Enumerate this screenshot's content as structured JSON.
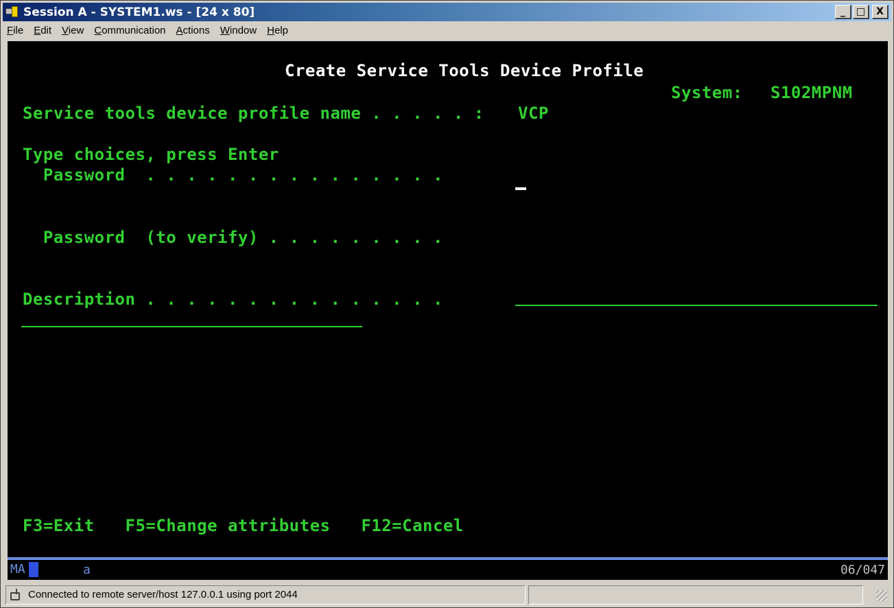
{
  "window": {
    "title": "Session A - SYSTEM1.ws - [24 x 80]",
    "buttons": {
      "minimize": "_",
      "maximize": "□",
      "close": "X"
    }
  },
  "menubar": {
    "items": [
      {
        "label": "File",
        "underline": "F",
        "rest": "ile"
      },
      {
        "label": "Edit",
        "underline": "E",
        "rest": "dit"
      },
      {
        "label": "View",
        "underline": "V",
        "rest": "iew"
      },
      {
        "label": "Communication",
        "underline": "C",
        "rest": "ommunication"
      },
      {
        "label": "Actions",
        "underline": "A",
        "rest": "ctions"
      },
      {
        "label": "Window",
        "underline": "W",
        "rest": "indow"
      },
      {
        "label": "Help",
        "underline": "H",
        "rest": "elp"
      }
    ]
  },
  "screen": {
    "heading": "Create Service Tools Device Profile",
    "system_label": "System:",
    "system_value": "S102MPNM",
    "profile_name_label": "Service tools device profile name . . . . . :",
    "profile_name_value": "VCP",
    "instruction": "Type choices, press Enter",
    "password_label": "  Password  . . . . . . . . . . . . . . .",
    "password_verify_label": "  Password  (to verify) . . . . . . . . .",
    "description_label": "Description . . . . . . . . . . . . . . .",
    "function_keys": "F3=Exit   F5=Change attributes   F12=Cancel"
  },
  "oia": {
    "ma": "MA",
    "mode": "a",
    "cursor_position": "06/047"
  },
  "statusbar": {
    "message": "Connected to remote server/host 127.0.0.1 using port 2044",
    "secondary": ""
  },
  "colors": {
    "terminal_bg": "#000000",
    "terminal_text": "#32d032",
    "title_bar": "#0a246a"
  }
}
